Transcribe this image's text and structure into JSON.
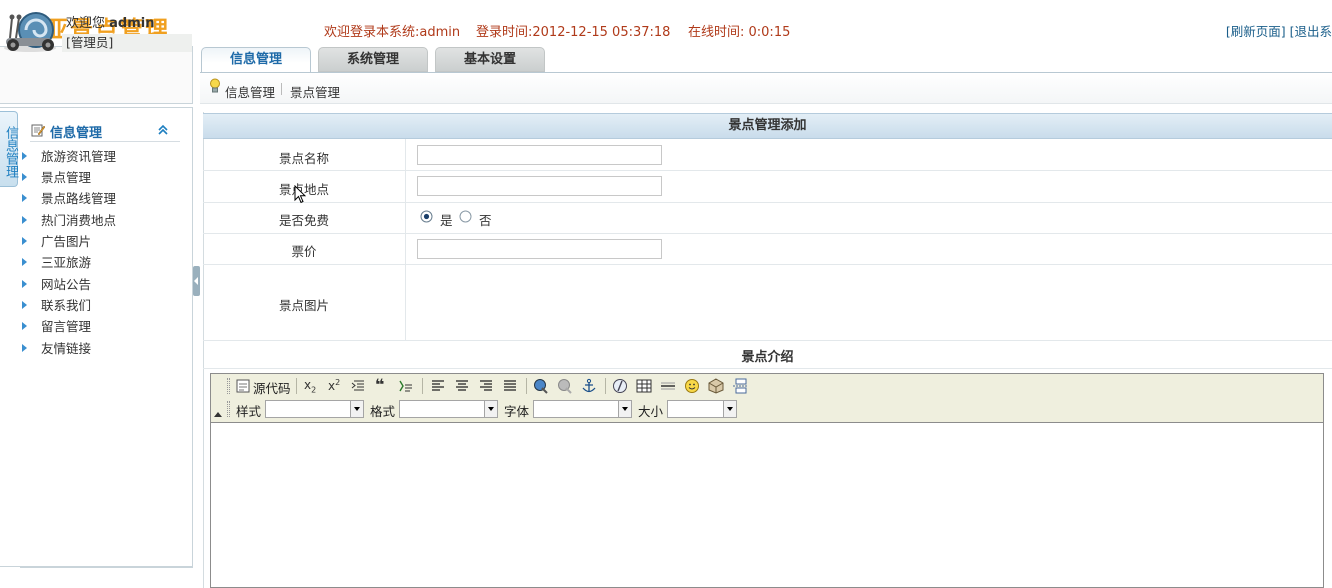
{
  "header": {
    "app_title": "三亚景点管理",
    "welcome_text": "欢迎登录本系统:admin",
    "login_time_text": "登录时间:2012-12-15 05:37:18",
    "online_time_text": "在线时间: 0:0:15",
    "refresh_link": "[刷新页面]",
    "logout_link": "[退出系"
  },
  "user": {
    "welcome_prefix": "欢迎您",
    "username": "admin",
    "role": "[管理员]"
  },
  "sidebar": {
    "vertical_tab": "信息管理",
    "section_title": "信息管理",
    "items": [
      {
        "label": "旅游资讯管理"
      },
      {
        "label": "景点管理"
      },
      {
        "label": "景点路线管理"
      },
      {
        "label": "热门消费地点"
      },
      {
        "label": "广告图片"
      },
      {
        "label": "三亚旅游"
      },
      {
        "label": "网站公告"
      },
      {
        "label": "联系我们"
      },
      {
        "label": "留言管理"
      },
      {
        "label": "友情链接"
      }
    ]
  },
  "tabs": [
    {
      "label": "信息管理",
      "active": true
    },
    {
      "label": "系统管理",
      "active": false
    },
    {
      "label": "基本设置",
      "active": false
    }
  ],
  "breadcrumb": [
    "信息管理",
    "景点管理"
  ],
  "form": {
    "title": "景点管理添加",
    "fields": {
      "name_label": "景点名称",
      "name_value": "",
      "location_label": "景点地点",
      "location_value": "",
      "free_label": "是否免费",
      "free_yes": "是",
      "free_no": "否",
      "free_selected": "是",
      "price_label": "票价",
      "price_value": "",
      "image_label": "景点图片"
    },
    "intro_label": "景点介绍"
  },
  "editor": {
    "source_button": "源代码",
    "style_label": "样式",
    "format_label": "格式",
    "font_label": "字体",
    "size_label": "大小",
    "style_value": "",
    "format_value": "",
    "font_value": "",
    "size_value": ""
  },
  "colors": {
    "title_orange": "#f0a020",
    "header_info": "#b03a1a",
    "link_blue": "#1a5e8a",
    "menu_blue": "#1e6aa8",
    "toolbar_bg": "#efefde"
  }
}
